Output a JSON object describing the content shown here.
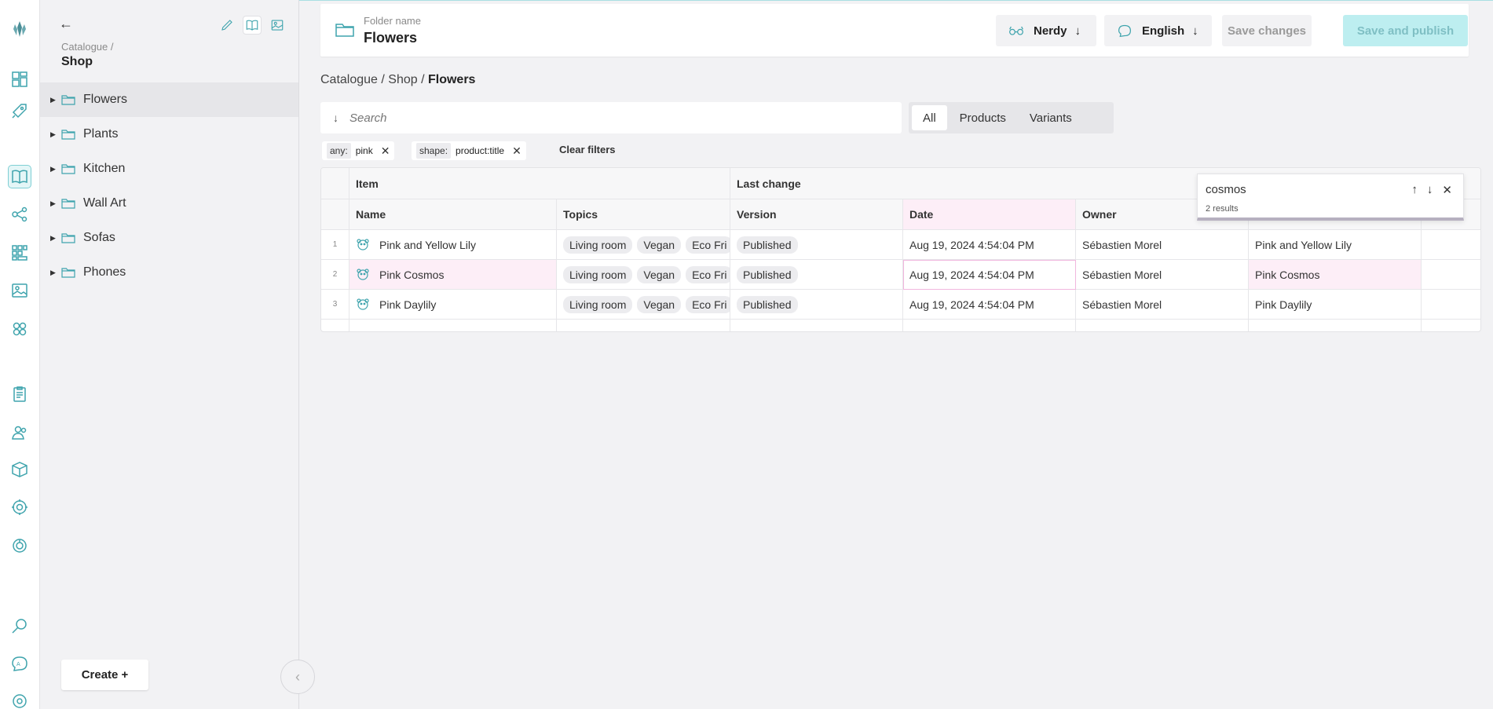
{
  "rail": {
    "icons": [
      "logo-crystal-icon",
      "dashboard-icon",
      "rocket-icon",
      "catalogue-book-icon",
      "graph-nodes-icon",
      "grid-apps-icon",
      "media-image-icon",
      "components-icon",
      "orders-clipboard-icon",
      "customers-icon",
      "subscriptions-box-icon",
      "settings-gear-icon",
      "analytics-donut-icon",
      "search-magnifier-icon",
      "translation-chat-icon",
      "system-settings-icon"
    ]
  },
  "tree": {
    "back_glyph": "←",
    "crumb_small": "Catalogue  /",
    "crumb_title": "Shop",
    "items": [
      {
        "label": "Flowers",
        "selected": true
      },
      {
        "label": "Plants",
        "selected": false
      },
      {
        "label": "Kitchen",
        "selected": false
      },
      {
        "label": "Wall Art",
        "selected": false
      },
      {
        "label": "Sofas",
        "selected": false
      },
      {
        "label": "Phones",
        "selected": false
      }
    ],
    "create_label": "Create +",
    "collapse_glyph": "‹"
  },
  "header": {
    "folder_label": "Folder name",
    "folder_value": "Flowers",
    "mode_label": "Nerdy",
    "language_label": "English",
    "arrow_glyph": "↓",
    "save_label": "Save changes",
    "publish_label": "Save and publish"
  },
  "breadcrumb": {
    "path": "Catalogue / Shop / ",
    "current": "Flowers"
  },
  "search": {
    "placeholder": "Search",
    "arrow_glyph": "↓"
  },
  "segments": {
    "all": "All",
    "products": "Products",
    "variants": "Variants"
  },
  "filters": [
    {
      "key": "any:",
      "value": "pink"
    },
    {
      "key": "shape:",
      "value": "product:title"
    }
  ],
  "clear_filters_label": "Clear filters",
  "table": {
    "group_item": "Item",
    "group_last_change": "Last change",
    "columns": [
      "Name",
      "Topics",
      "Version",
      "Date",
      "Owner"
    ],
    "rows": [
      {
        "num": "1",
        "name": "Pink and Yellow Lily",
        "topics": [
          "Living room",
          "Vegan",
          "Eco Fri"
        ],
        "version": "Published",
        "date": "Aug 19, 2024 4:54:04 PM",
        "owner": "Sébastien Morel",
        "extra": "Pink and Yellow Lily"
      },
      {
        "num": "2",
        "name": "Pink Cosmos",
        "topics": [
          "Living room",
          "Vegan",
          "Eco Fri"
        ],
        "version": "Published",
        "date": "Aug 19, 2024 4:54:04 PM",
        "owner": "Sébastien Morel",
        "extra": "Pink Cosmos"
      },
      {
        "num": "3",
        "name": "Pink Daylily",
        "topics": [
          "Living room",
          "Vegan",
          "Eco Fri"
        ],
        "version": "Published",
        "date": "Aug 19, 2024 4:54:04 PM",
        "owner": "Sébastien Morel",
        "extra": "Pink Daylily"
      }
    ]
  },
  "find": {
    "query": "cosmos",
    "results": "2 results",
    "up_glyph": "↑",
    "down_glyph": "↓",
    "close_glyph": "✕"
  },
  "colors": {
    "accent": "#4db8c0",
    "highlight_row": "#fdeef7",
    "publish_bg": "#bdeef0"
  }
}
